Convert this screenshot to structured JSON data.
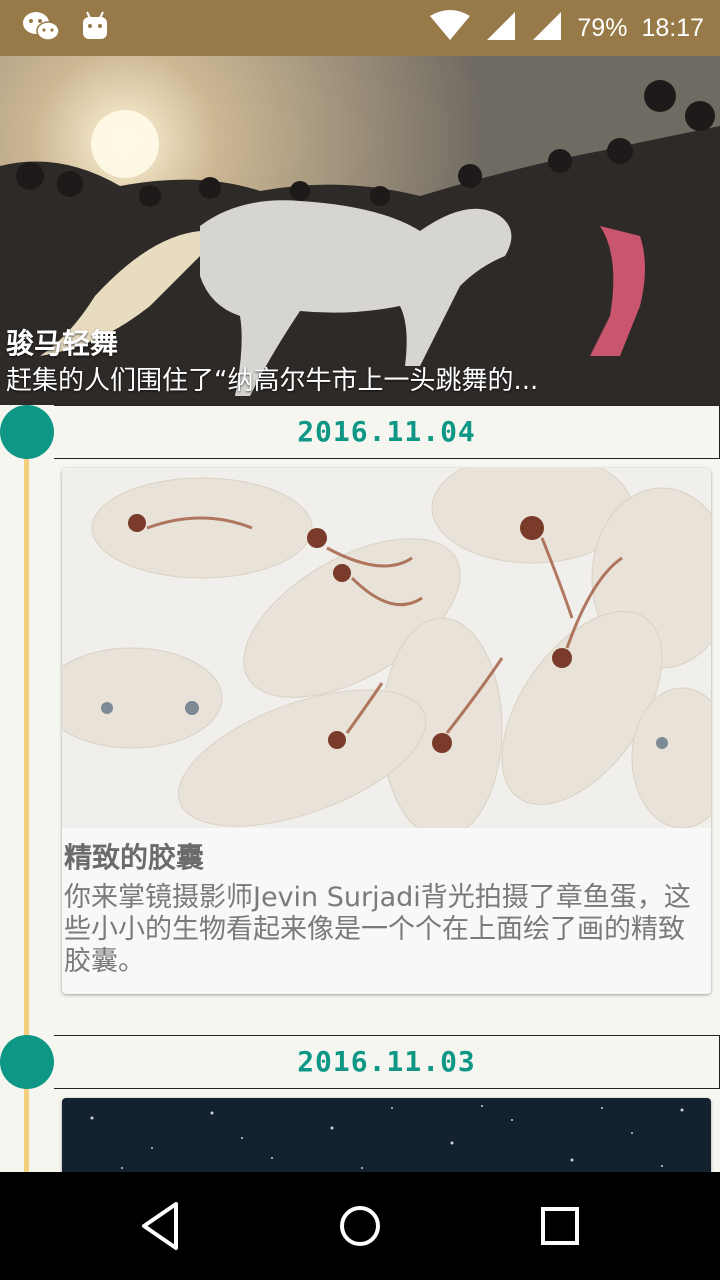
{
  "status_bar": {
    "battery": "79%",
    "time": "18:17",
    "icons": [
      "wechat-icon",
      "android-icon",
      "wifi-icon",
      "signal-icon",
      "signal-icon"
    ]
  },
  "hero": {
    "title": "骏马轻舞",
    "subtitle": "赶集的人们围住了“纳高尔牛市上一头跳舞的..."
  },
  "timeline": [
    {
      "date": "2016.11.04",
      "card": {
        "title": "精致的胶囊",
        "desc": "你来掌镜摄影师Jevin Surjadi背光拍摄了章鱼蛋，这些小小的生物看起来像是一个个在上面绘了画的精致胶囊。"
      }
    },
    {
      "date": "2016.11.03"
    }
  ],
  "nav": {
    "icons": [
      "back-icon",
      "home-icon",
      "recents-icon"
    ]
  },
  "colors": {
    "status_bar": "#977a48",
    "accent": "#0e9785",
    "timeline_line": "#f4cf7e",
    "background": "#f6f6f1"
  }
}
